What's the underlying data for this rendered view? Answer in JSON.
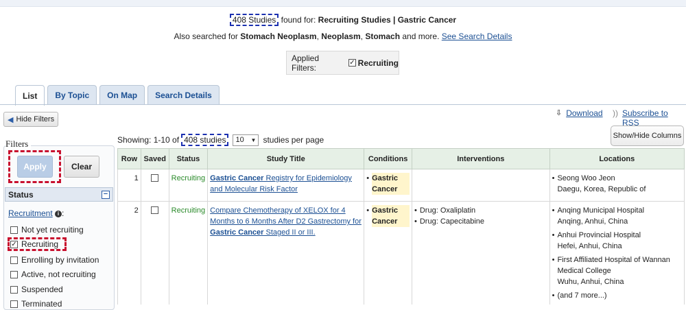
{
  "summary": {
    "count": "408 Studies",
    "found_for": "found for:",
    "query": "Recruiting Studies | Gastric Cancer"
  },
  "also_searched": {
    "prefix": "Also searched for",
    "term1": "Stomach Neoplasm",
    "sep": ",",
    "term2": "Neoplasm",
    "term3": "Stomach",
    "suffix": "and more.",
    "link": "See Search Details"
  },
  "applied_filters": {
    "label": "Applied Filters:",
    "value": "Recruiting"
  },
  "tabs": [
    {
      "label": "List"
    },
    {
      "label": "By Topic"
    },
    {
      "label": "On Map"
    },
    {
      "label": "Search Details"
    }
  ],
  "toolbar": {
    "hide_filters": "Hide Filters",
    "download": "Download",
    "rss": "Subscribe to RSS",
    "show_hide_columns": "Show/Hide Columns"
  },
  "filters": {
    "title": "Filters",
    "apply": "Apply",
    "clear": "Clear",
    "status_header": "Status",
    "recruitment_label": "Recruitment",
    "options": [
      {
        "label": "Not yet recruiting",
        "checked": false
      },
      {
        "label": "Recruiting",
        "checked": true
      },
      {
        "label": "Enrolling by invitation",
        "checked": false
      },
      {
        "label": "Active, not recruiting",
        "checked": false
      },
      {
        "label": "Suspended",
        "checked": false
      },
      {
        "label": "Terminated",
        "checked": false
      }
    ]
  },
  "results": {
    "showing_prefix": "Showing: 1-10 of",
    "showing_count": "408 studies",
    "per_page_value": "10",
    "per_page_suffix": "studies per page",
    "columns": [
      "Row",
      "Saved",
      "Status",
      "Study Title",
      "Conditions",
      "Interventions",
      "Locations"
    ],
    "rows": [
      {
        "row": "1",
        "status": "Recruiting",
        "title_hl": "Gastric Cancer",
        "title_rest": "Registry for Epidemiology and Molecular Risk Factor",
        "condition": "Gastric Cancer",
        "interventions": [],
        "locations": [
          {
            "name": "Seong Woo Jeon",
            "place": "Daegu, Korea, Republic of"
          }
        ]
      },
      {
        "row": "2",
        "status": "Recruiting",
        "title_pre": "Compare Chemotherapy of XELOX for 4 Months to 6 Months After D2 Gastrectomy for",
        "title_hl": "Gastric Cancer",
        "title_post": "Staged II or III.",
        "condition": "Gastric Cancer",
        "interventions": [
          "Drug: Oxaliplatin",
          "Drug: Capecitabine"
        ],
        "locations": [
          {
            "name": "Anqing Municipal Hospital",
            "place": "Anqing, Anhui, China"
          },
          {
            "name": "Anhui Provincial Hospital",
            "place": "Hefei, Anhui, China"
          },
          {
            "name": "First Affiliated Hospital of Wannan Medical College",
            "place": "Wuhu, Anhui, China"
          }
        ],
        "more": "(and 7 more...)"
      }
    ]
  }
}
